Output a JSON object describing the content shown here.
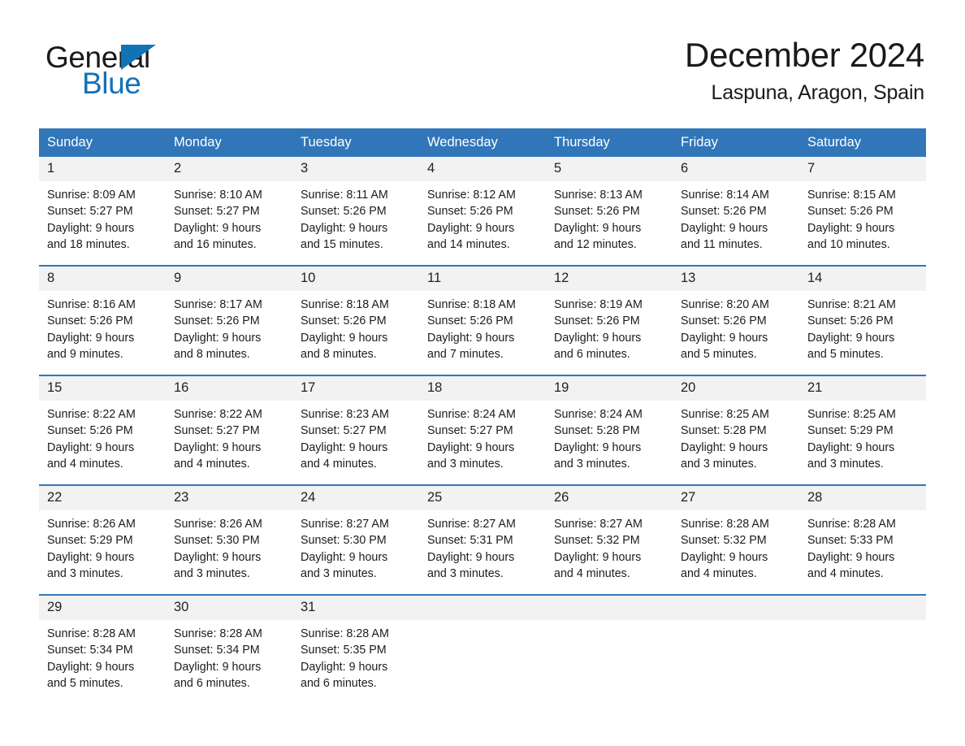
{
  "logo": {
    "word1": "General",
    "word2": "Blue",
    "triangle_color": "#1272b6",
    "text_color": "#1a1a1a"
  },
  "header": {
    "title": "December 2024",
    "location": "Laspuna, Aragon, Spain"
  },
  "theme": {
    "header_blue": "#3176b8",
    "row_gray": "#f2f2f2",
    "text": "#1c1c1c"
  },
  "weekday_headers": [
    "Sunday",
    "Monday",
    "Tuesday",
    "Wednesday",
    "Thursday",
    "Friday",
    "Saturday"
  ],
  "weeks": [
    [
      {
        "day": "1",
        "sunrise": "Sunrise: 8:09 AM",
        "sunset": "Sunset: 5:27 PM",
        "daylight1": "Daylight: 9 hours",
        "daylight2": "and 18 minutes."
      },
      {
        "day": "2",
        "sunrise": "Sunrise: 8:10 AM",
        "sunset": "Sunset: 5:27 PM",
        "daylight1": "Daylight: 9 hours",
        "daylight2": "and 16 minutes."
      },
      {
        "day": "3",
        "sunrise": "Sunrise: 8:11 AM",
        "sunset": "Sunset: 5:26 PM",
        "daylight1": "Daylight: 9 hours",
        "daylight2": "and 15 minutes."
      },
      {
        "day": "4",
        "sunrise": "Sunrise: 8:12 AM",
        "sunset": "Sunset: 5:26 PM",
        "daylight1": "Daylight: 9 hours",
        "daylight2": "and 14 minutes."
      },
      {
        "day": "5",
        "sunrise": "Sunrise: 8:13 AM",
        "sunset": "Sunset: 5:26 PM",
        "daylight1": "Daylight: 9 hours",
        "daylight2": "and 12 minutes."
      },
      {
        "day": "6",
        "sunrise": "Sunrise: 8:14 AM",
        "sunset": "Sunset: 5:26 PM",
        "daylight1": "Daylight: 9 hours",
        "daylight2": "and 11 minutes."
      },
      {
        "day": "7",
        "sunrise": "Sunrise: 8:15 AM",
        "sunset": "Sunset: 5:26 PM",
        "daylight1": "Daylight: 9 hours",
        "daylight2": "and 10 minutes."
      }
    ],
    [
      {
        "day": "8",
        "sunrise": "Sunrise: 8:16 AM",
        "sunset": "Sunset: 5:26 PM",
        "daylight1": "Daylight: 9 hours",
        "daylight2": "and 9 minutes."
      },
      {
        "day": "9",
        "sunrise": "Sunrise: 8:17 AM",
        "sunset": "Sunset: 5:26 PM",
        "daylight1": "Daylight: 9 hours",
        "daylight2": "and 8 minutes."
      },
      {
        "day": "10",
        "sunrise": "Sunrise: 8:18 AM",
        "sunset": "Sunset: 5:26 PM",
        "daylight1": "Daylight: 9 hours",
        "daylight2": "and 8 minutes."
      },
      {
        "day": "11",
        "sunrise": "Sunrise: 8:18 AM",
        "sunset": "Sunset: 5:26 PM",
        "daylight1": "Daylight: 9 hours",
        "daylight2": "and 7 minutes."
      },
      {
        "day": "12",
        "sunrise": "Sunrise: 8:19 AM",
        "sunset": "Sunset: 5:26 PM",
        "daylight1": "Daylight: 9 hours",
        "daylight2": "and 6 minutes."
      },
      {
        "day": "13",
        "sunrise": "Sunrise: 8:20 AM",
        "sunset": "Sunset: 5:26 PM",
        "daylight1": "Daylight: 9 hours",
        "daylight2": "and 5 minutes."
      },
      {
        "day": "14",
        "sunrise": "Sunrise: 8:21 AM",
        "sunset": "Sunset: 5:26 PM",
        "daylight1": "Daylight: 9 hours",
        "daylight2": "and 5 minutes."
      }
    ],
    [
      {
        "day": "15",
        "sunrise": "Sunrise: 8:22 AM",
        "sunset": "Sunset: 5:26 PM",
        "daylight1": "Daylight: 9 hours",
        "daylight2": "and 4 minutes."
      },
      {
        "day": "16",
        "sunrise": "Sunrise: 8:22 AM",
        "sunset": "Sunset: 5:27 PM",
        "daylight1": "Daylight: 9 hours",
        "daylight2": "and 4 minutes."
      },
      {
        "day": "17",
        "sunrise": "Sunrise: 8:23 AM",
        "sunset": "Sunset: 5:27 PM",
        "daylight1": "Daylight: 9 hours",
        "daylight2": "and 4 minutes."
      },
      {
        "day": "18",
        "sunrise": "Sunrise: 8:24 AM",
        "sunset": "Sunset: 5:27 PM",
        "daylight1": "Daylight: 9 hours",
        "daylight2": "and 3 minutes."
      },
      {
        "day": "19",
        "sunrise": "Sunrise: 8:24 AM",
        "sunset": "Sunset: 5:28 PM",
        "daylight1": "Daylight: 9 hours",
        "daylight2": "and 3 minutes."
      },
      {
        "day": "20",
        "sunrise": "Sunrise: 8:25 AM",
        "sunset": "Sunset: 5:28 PM",
        "daylight1": "Daylight: 9 hours",
        "daylight2": "and 3 minutes."
      },
      {
        "day": "21",
        "sunrise": "Sunrise: 8:25 AM",
        "sunset": "Sunset: 5:29 PM",
        "daylight1": "Daylight: 9 hours",
        "daylight2": "and 3 minutes."
      }
    ],
    [
      {
        "day": "22",
        "sunrise": "Sunrise: 8:26 AM",
        "sunset": "Sunset: 5:29 PM",
        "daylight1": "Daylight: 9 hours",
        "daylight2": "and 3 minutes."
      },
      {
        "day": "23",
        "sunrise": "Sunrise: 8:26 AM",
        "sunset": "Sunset: 5:30 PM",
        "daylight1": "Daylight: 9 hours",
        "daylight2": "and 3 minutes."
      },
      {
        "day": "24",
        "sunrise": "Sunrise: 8:27 AM",
        "sunset": "Sunset: 5:30 PM",
        "daylight1": "Daylight: 9 hours",
        "daylight2": "and 3 minutes."
      },
      {
        "day": "25",
        "sunrise": "Sunrise: 8:27 AM",
        "sunset": "Sunset: 5:31 PM",
        "daylight1": "Daylight: 9 hours",
        "daylight2": "and 3 minutes."
      },
      {
        "day": "26",
        "sunrise": "Sunrise: 8:27 AM",
        "sunset": "Sunset: 5:32 PM",
        "daylight1": "Daylight: 9 hours",
        "daylight2": "and 4 minutes."
      },
      {
        "day": "27",
        "sunrise": "Sunrise: 8:28 AM",
        "sunset": "Sunset: 5:32 PM",
        "daylight1": "Daylight: 9 hours",
        "daylight2": "and 4 minutes."
      },
      {
        "day": "28",
        "sunrise": "Sunrise: 8:28 AM",
        "sunset": "Sunset: 5:33 PM",
        "daylight1": "Daylight: 9 hours",
        "daylight2": "and 4 minutes."
      }
    ],
    [
      {
        "day": "29",
        "sunrise": "Sunrise: 8:28 AM",
        "sunset": "Sunset: 5:34 PM",
        "daylight1": "Daylight: 9 hours",
        "daylight2": "and 5 minutes."
      },
      {
        "day": "30",
        "sunrise": "Sunrise: 8:28 AM",
        "sunset": "Sunset: 5:34 PM",
        "daylight1": "Daylight: 9 hours",
        "daylight2": "and 6 minutes."
      },
      {
        "day": "31",
        "sunrise": "Sunrise: 8:28 AM",
        "sunset": "Sunset: 5:35 PM",
        "daylight1": "Daylight: 9 hours",
        "daylight2": "and 6 minutes."
      },
      {
        "day": "",
        "sunrise": "",
        "sunset": "",
        "daylight1": "",
        "daylight2": ""
      },
      {
        "day": "",
        "sunrise": "",
        "sunset": "",
        "daylight1": "",
        "daylight2": ""
      },
      {
        "day": "",
        "sunrise": "",
        "sunset": "",
        "daylight1": "",
        "daylight2": ""
      },
      {
        "day": "",
        "sunrise": "",
        "sunset": "",
        "daylight1": "",
        "daylight2": ""
      }
    ]
  ]
}
